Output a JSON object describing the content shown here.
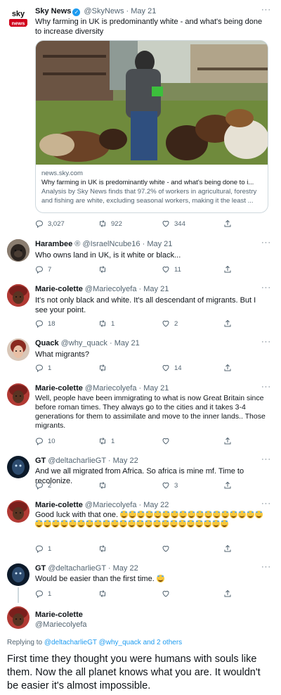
{
  "colors": {
    "link": "#1d9bf0",
    "text": "#0f1419",
    "muted": "#536471",
    "border": "#cfd9de",
    "like_red": "#f91880"
  },
  "tweets": [
    {
      "name": "Sky News",
      "handle": "@SkyNews",
      "date": "May 21",
      "verified": true,
      "text": "Why farming in UK is predominantly white - and what's being done to increase diversity",
      "card": {
        "domain": "news.sky.com",
        "title": "Why farming in UK is predominantly white - and what's being done to i...",
        "desc": "Analysis by Sky News finds that 97.2% of workers in agricultural, forestry and fishing are white, excluding seasonal workers, making it the least ..."
      },
      "replies": "3,027",
      "retweets": "922",
      "likes": "344"
    },
    {
      "name": "Harambee",
      "badge": "®",
      "handle": "@IsraelNcube16",
      "date": "May 21",
      "text": "Who owns land in UK, is it white or black...",
      "replies": "7",
      "retweets": "",
      "likes": "11"
    },
    {
      "name": "Marie-colette",
      "handle": "@Mariecolyefa",
      "date": "May 21",
      "text": "It's not only black and white. It's all descendant of migrants. But I see your point.",
      "replies": "18",
      "retweets": "1",
      "likes": "2"
    },
    {
      "name": "Quack",
      "handle": "@why_quack",
      "date": "May 21",
      "text": "What migrants?",
      "replies": "1",
      "retweets": "",
      "likes": "14"
    },
    {
      "name": "Marie-colette",
      "handle": "@Mariecolyefa",
      "date": "May 21",
      "text": "Well, people have been immigrating to what is now Great Britain since before roman times. They always go to the cities and it takes 3-4 generations for them to assimilate and move to the inner lands.. Those migrants.",
      "replies": "10",
      "retweets": "1",
      "likes": ""
    },
    {
      "name": "GT",
      "handle": "@deltacharlieGT",
      "date": "May 22",
      "text": "And we all migrated from Africa. So africa is mine mf. Time to recolonize.",
      "replies": "2",
      "retweets": "",
      "likes": "3"
    },
    {
      "name": "Marie-colette",
      "handle": "@Mariecolyefa",
      "date": "May 22",
      "text": "Good luck with that one.",
      "emoji_count": 40,
      "replies": "1",
      "retweets": "",
      "likes": ""
    },
    {
      "name": "GT",
      "handle": "@deltacharlieGT",
      "date": "May 22",
      "text": "Would be easier than the first time.",
      "emoji_count": 1,
      "replies": "1",
      "retweets": "",
      "likes": ""
    }
  ],
  "main": {
    "name": "Marie-colette",
    "handle": "@Mariecolyefa",
    "replying_prefix": "Replying to",
    "replying_to": "@deltacharlieGT @why_quack",
    "replying_suffix": "and 2 others",
    "text": "First time they thought you were humans with souls like them. Now the all planet knows what you are. It wouldn't be easier it's almost impossible."
  },
  "icons": {
    "reply": "reply-icon",
    "retweet": "retweet-icon",
    "like": "heart-icon",
    "share": "share-icon",
    "more": "more-icon"
  },
  "ui": {
    "more_glyph": "···",
    "sep": " · "
  }
}
